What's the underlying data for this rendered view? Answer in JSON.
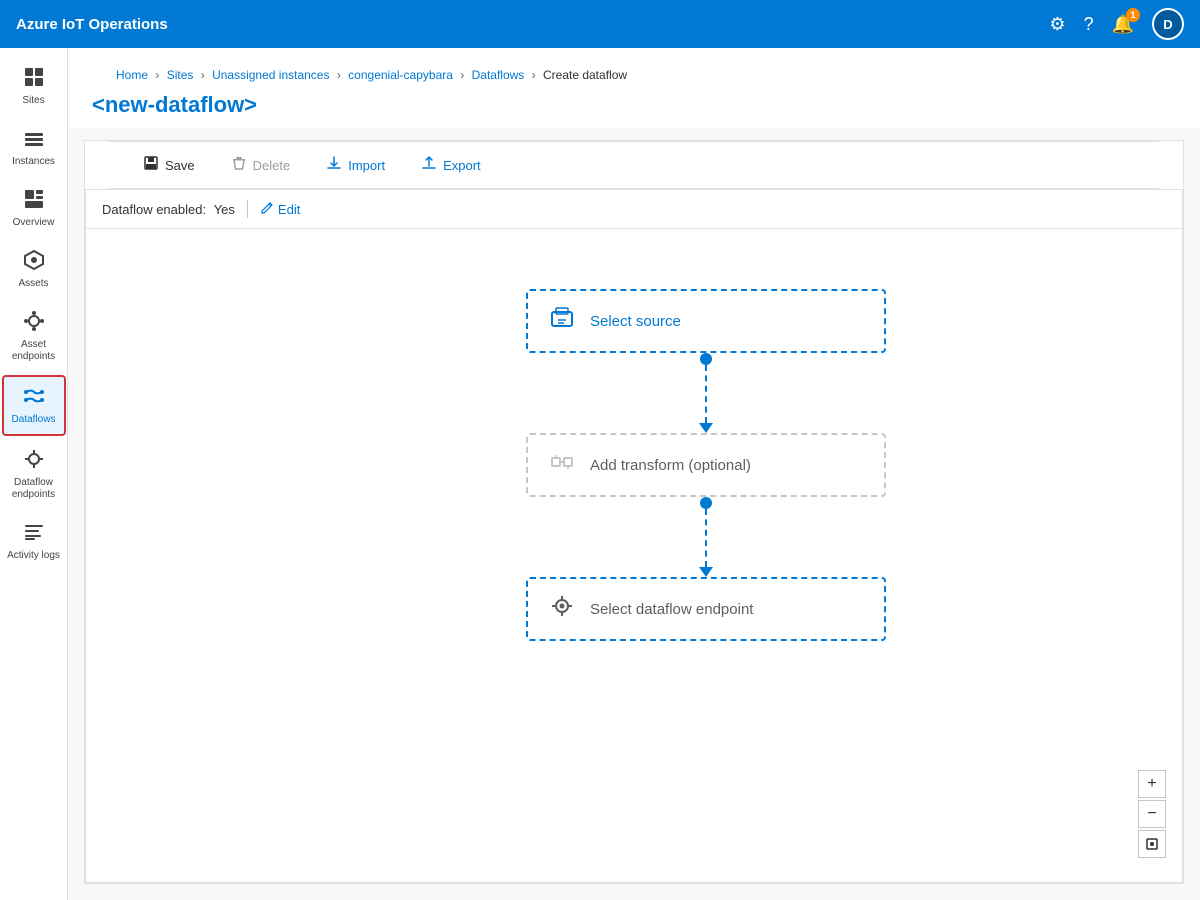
{
  "topbar": {
    "title": "Azure IoT Operations",
    "notification_count": "1",
    "avatar_label": "D"
  },
  "sidebar": {
    "items": [
      {
        "id": "sites",
        "label": "Sites",
        "icon": "⊞",
        "active": false
      },
      {
        "id": "instances",
        "label": "Instances",
        "icon": "⚙",
        "active": false
      },
      {
        "id": "overview",
        "label": "Overview",
        "icon": "▦",
        "active": false
      },
      {
        "id": "assets",
        "label": "Assets",
        "icon": "◈",
        "active": false
      },
      {
        "id": "asset-endpoints",
        "label": "Asset endpoints",
        "icon": "⬡",
        "active": false
      },
      {
        "id": "dataflows",
        "label": "Dataflows",
        "icon": "⇄",
        "active": true
      },
      {
        "id": "dataflow-endpoints",
        "label": "Dataflow endpoints",
        "icon": "⬡",
        "active": false
      },
      {
        "id": "activity-logs",
        "label": "Activity logs",
        "icon": "≡",
        "active": false
      }
    ]
  },
  "breadcrumb": {
    "items": [
      {
        "label": "Home",
        "link": true
      },
      {
        "label": "Sites",
        "link": true
      },
      {
        "label": "Unassigned instances",
        "link": true
      },
      {
        "label": "congenial-capybara",
        "link": true
      },
      {
        "label": "Dataflows",
        "link": true
      },
      {
        "label": "Create dataflow",
        "link": false
      }
    ]
  },
  "page": {
    "title": "<new-dataflow>"
  },
  "toolbar": {
    "save_label": "Save",
    "delete_label": "Delete",
    "import_label": "Import",
    "export_label": "Export"
  },
  "dataflow_status": {
    "label": "Dataflow enabled:",
    "value": "Yes",
    "edit_label": "Edit"
  },
  "flow_nodes": [
    {
      "id": "source",
      "label": "Select source",
      "icon": "📦",
      "optional": false
    },
    {
      "id": "transform",
      "label": "Add transform (optional)",
      "icon": "⊞",
      "optional": true
    },
    {
      "id": "endpoint",
      "label": "Select dataflow endpoint",
      "icon": "🔗",
      "optional": false
    }
  ],
  "zoom_controls": {
    "zoom_in": "+",
    "zoom_out": "−",
    "reset": "⊙"
  }
}
